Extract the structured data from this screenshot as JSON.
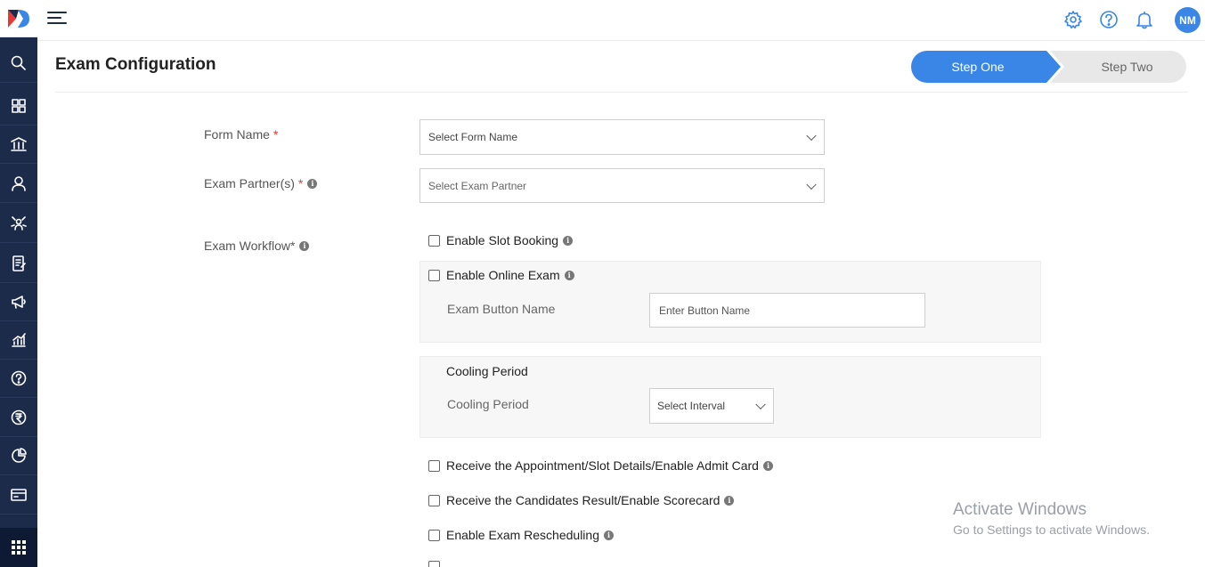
{
  "topbar": {
    "avatar_initials": "NM",
    "icons": [
      "gear-icon",
      "help-icon",
      "bell-icon"
    ]
  },
  "sidebar": {
    "items": [
      "search-icon",
      "dashboard-icon",
      "institution-icon",
      "user-icon",
      "network-icon",
      "form-icon",
      "megaphone-icon",
      "analytics-icon",
      "help-icon",
      "rupee-icon",
      "pie-chart-icon",
      "card-icon",
      "apps-grid-icon"
    ]
  },
  "header": {
    "title": "Exam Configuration",
    "steps": [
      "Step One",
      "Step Two"
    ],
    "active_step": "Step One"
  },
  "form": {
    "form_name_label": "Form Name",
    "form_name_placeholder": "Select Form Name",
    "exam_partner_label": "Exam Partner(s)",
    "exam_partner_placeholder": "Select Exam Partner",
    "workflow_label": "Exam Workflow*",
    "required_mark": "*",
    "enable_slot_booking": "Enable Slot Booking",
    "enable_online_exam": "Enable Online Exam",
    "exam_button_name_label": "Exam Button Name",
    "exam_button_name_placeholder": "Enter Button Name",
    "cooling_period_heading": "Cooling Period",
    "cooling_period_label": "Cooling Period",
    "cooling_period_value": "Select Interval",
    "receive_appointment": "Receive the Appointment/Slot Details/Enable Admit Card",
    "receive_result": "Receive the Candidates Result/Enable Scorecard",
    "enable_rescheduling": "Enable Exam Rescheduling"
  },
  "watermark": {
    "line1": "Activate Windows",
    "line2": "Go to Settings to activate Windows."
  },
  "colors": {
    "sidebar": "#1c2b4a",
    "accent": "#3a86e6"
  }
}
